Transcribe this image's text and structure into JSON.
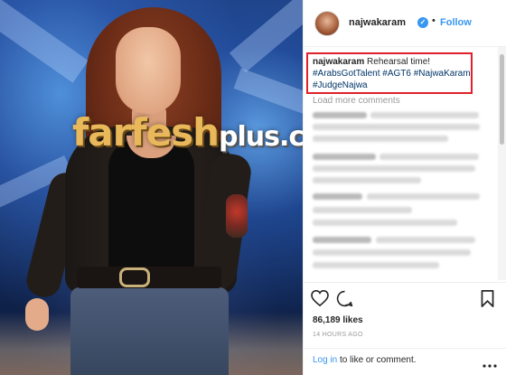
{
  "post": {
    "username": "najwakaram",
    "verified_icon": "verified-badge-icon",
    "separator": "•",
    "follow_label": "Follow"
  },
  "caption": {
    "username": "najwakaram",
    "text": "Rehearsal time!",
    "hashtags": [
      "#ArabsGotTalent",
      "#AGT6",
      "#NajwaKaram",
      "#JudgeNajwa"
    ]
  },
  "comments": {
    "load_more_label": "Load more comments"
  },
  "watermark": {
    "main": "farfesh",
    "suffix": "plus.com"
  },
  "stats": {
    "likes": "86,189 likes",
    "time_ago": "14 HOURS AGO"
  },
  "footer": {
    "login_link": "Log in",
    "login_rest": " to like or comment."
  },
  "icons": {
    "like": "heart-icon",
    "comment": "comment-bubble-icon",
    "save": "bookmark-icon",
    "more": "ellipsis-icon"
  },
  "colors": {
    "link_blue": "#3897f0",
    "hashtag_blue": "#003569",
    "highlight_red": "#e0202a"
  }
}
